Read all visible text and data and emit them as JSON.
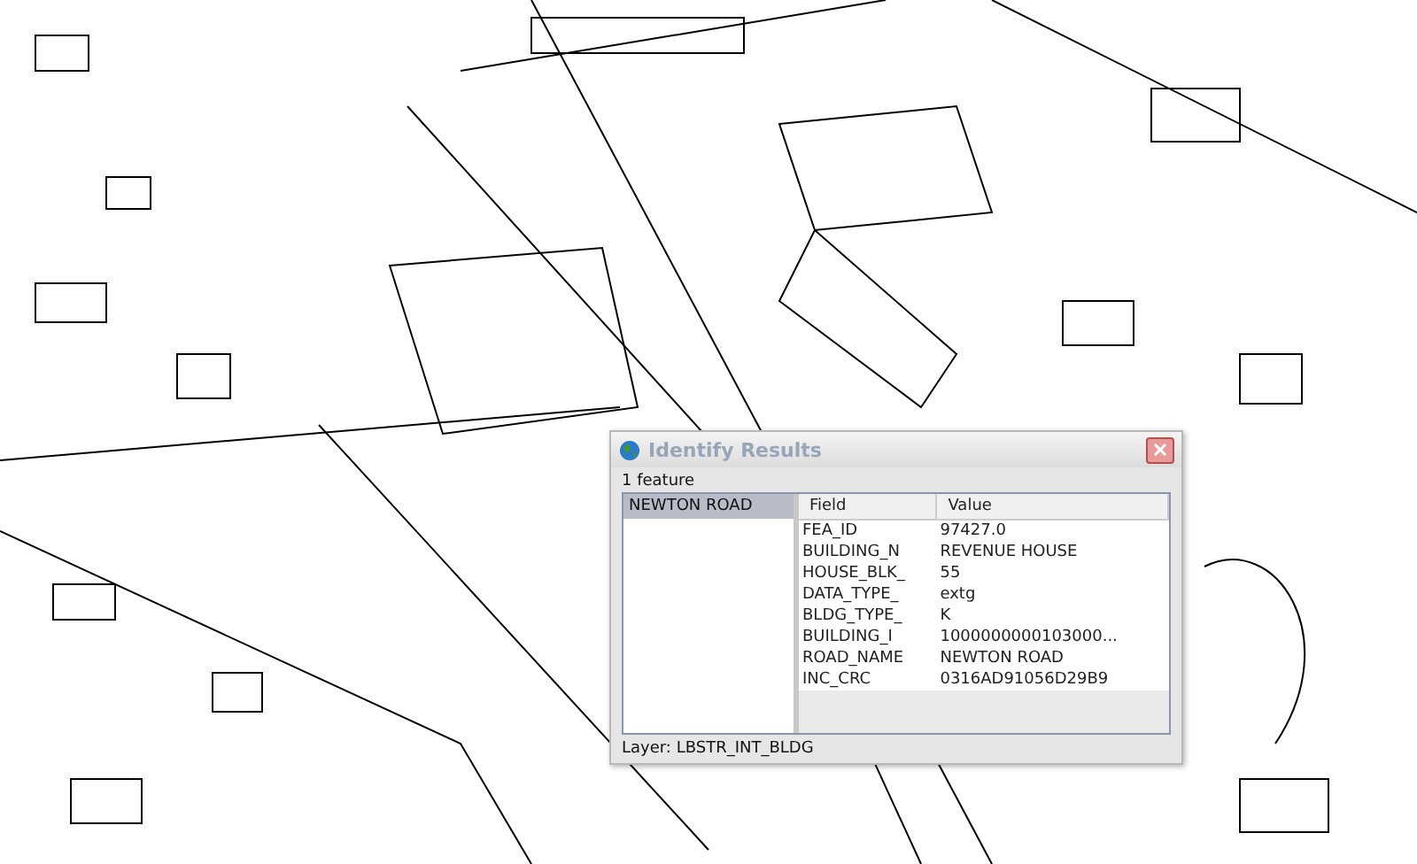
{
  "dialog": {
    "title": "Identify Results",
    "count": "1 feature",
    "features": [
      {
        "label": "NEWTON ROAD",
        "selected": true
      }
    ],
    "table": {
      "columns": [
        "Field",
        "Value"
      ],
      "rows": [
        {
          "field": "FEA_ID",
          "value": "97427.0"
        },
        {
          "field": "BUILDING_N",
          "value": "REVENUE HOUSE"
        },
        {
          "field": "HOUSE_BLK_",
          "value": "55"
        },
        {
          "field": "DATA_TYPE_",
          "value": "extg"
        },
        {
          "field": "BLDG_TYPE_",
          "value": "K"
        },
        {
          "field": "BUILDING_I",
          "value": "1000000000103000..."
        },
        {
          "field": "ROAD_NAME",
          "value": "NEWTON ROAD"
        },
        {
          "field": "INC_CRC",
          "value": "0316AD91056D29B9"
        }
      ]
    },
    "layer": "Layer: LBSTR_INT_BLDG"
  }
}
